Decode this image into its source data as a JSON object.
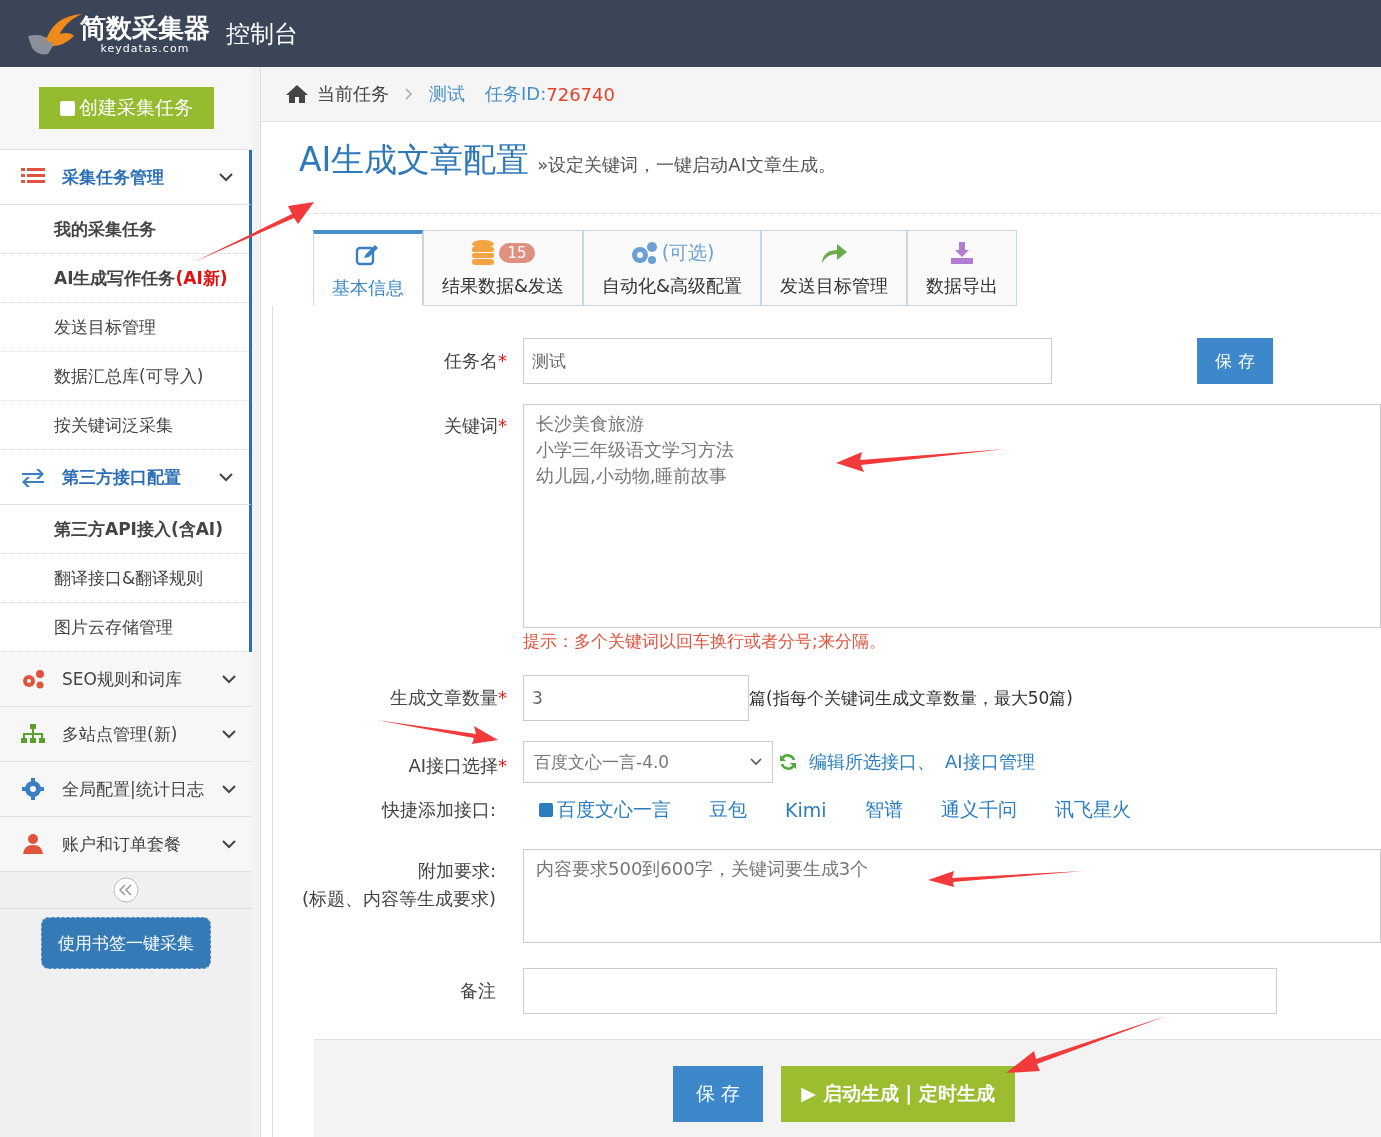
{
  "header": {
    "logo_name": "简数采集器",
    "logo_domain": "keydatas.com",
    "title": "控制台"
  },
  "sidebar": {
    "create_button": "创建采集任务",
    "groups": [
      {
        "label": "采集任务管理",
        "expanded": true,
        "children": [
          {
            "label": "我的采集任务",
            "bold": true
          },
          {
            "label": "AI生成写作任务",
            "tag": "(AI新)",
            "bold": true
          },
          {
            "label": "发送目标管理",
            "bold": false
          },
          {
            "label": "数据汇总库(可导入)",
            "bold": false
          },
          {
            "label": "按关键词泛采集",
            "bold": false
          }
        ]
      },
      {
        "label": "第三方接口配置",
        "expanded": true,
        "children": [
          {
            "label": "第三方API接入(含AI)",
            "bold": true
          },
          {
            "label": "翻译接口&翻译规则",
            "bold": false
          },
          {
            "label": "图片云存储管理",
            "bold": false
          }
        ]
      },
      {
        "label": "SEO规则和词库",
        "expanded": false
      },
      {
        "label": "多站点管理(新)",
        "expanded": false
      },
      {
        "label": "全局配置|统计日志",
        "expanded": false
      },
      {
        "label": "账户和订单套餐",
        "expanded": false
      }
    ],
    "bookmark_button": "使用书签一键采集"
  },
  "breadcrumb": {
    "home": "当前任务",
    "task": "测试",
    "id_label": "任务ID:",
    "id_value": "726740"
  },
  "page": {
    "title": "AI生成文章配置",
    "subtitle": "»设定关键词，一键启动AI文章生成。"
  },
  "tabs": [
    {
      "label": "基本信息",
      "selected": true
    },
    {
      "label": "结果数据&发送",
      "badge": "15",
      "selected": false
    },
    {
      "label": "自动化&高级配置",
      "note": "(可选)",
      "selected": false
    },
    {
      "label": "发送目标管理",
      "selected": false
    },
    {
      "label": "数据导出",
      "selected": false
    }
  ],
  "form": {
    "task_name": {
      "label": "任务名",
      "value": "测试",
      "save": "保 存"
    },
    "keywords": {
      "label": "关键词",
      "lines": [
        "长沙美食旅游",
        "小学三年级语文学习方法",
        "幼儿园,小动物,睡前故事"
      ],
      "hint": "提示：多个关键词以回车换行或者分号;来分隔。"
    },
    "count": {
      "label": "生成文章数量",
      "value": "3",
      "suffix": "篇(指每个关键词生成文章数量，最大50篇)"
    },
    "api": {
      "label": "AI接口选择",
      "value": "百度文心一言-4.0",
      "links": [
        "编辑所选接口、",
        "AI接口管理"
      ]
    },
    "quick_add": {
      "label": "快捷添加接口:",
      "items": [
        "百度文心一言",
        "豆包",
        "Kimi",
        "智谱",
        "通义千问",
        "讯飞星火"
      ]
    },
    "extra": {
      "label": "附加要求:",
      "label_note": "(标题、内容等生成要求)",
      "placeholder": "内容要求500到600字，关键词要生成3个"
    },
    "remark": {
      "label": "备注"
    },
    "required_mark": "*"
  },
  "footer": {
    "save": "保 存",
    "start": "启动生成 | 定时生成",
    "start_icon": "▶"
  }
}
